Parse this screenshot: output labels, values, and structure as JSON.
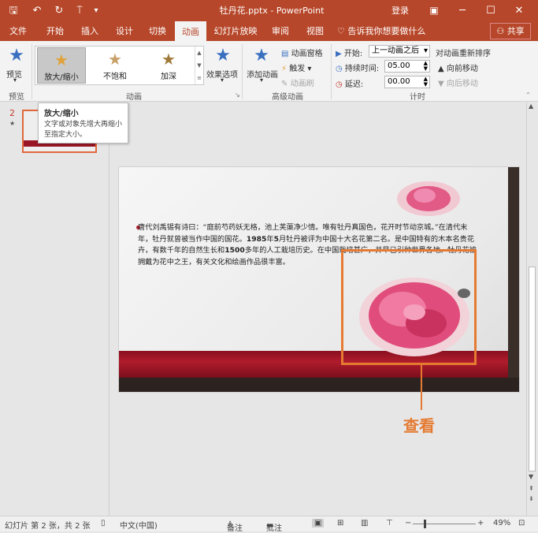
{
  "window": {
    "title": "牡丹花.pptx - PowerPoint",
    "login": "登录",
    "share": "共享",
    "search_hint": "告诉我你想要做什么"
  },
  "qat": {
    "save": "🖫",
    "undo": "↶",
    "redo": "↻",
    "present": "⍑",
    "more": "▾"
  },
  "tabs": [
    "文件",
    "开始",
    "插入",
    "设计",
    "切换",
    "动画",
    "幻灯片放映",
    "审阅",
    "视图"
  ],
  "ribbon": {
    "preview": {
      "label": "预览",
      "group": "预览"
    },
    "animations": {
      "items": [
        {
          "label": "放大/缩小",
          "color": "#e0a23a"
        },
        {
          "label": "不饱和",
          "color": "#c8a06a"
        },
        {
          "label": "加深",
          "color": "#a07a3a"
        }
      ],
      "effect_options": "效果选项",
      "group": "动画"
    },
    "advanced": {
      "add_animation": "添加动画",
      "pane": "动画窗格",
      "trigger": "触发",
      "painter": "动画刷",
      "group": "高级动画"
    },
    "timing": {
      "start_label": "开始:",
      "start_value": "上一动画之后",
      "duration_label": "持续时间:",
      "duration_value": "05.00",
      "delay_label": "延迟:",
      "delay_value": "00.00",
      "reorder_title": "对动画重新排序",
      "earlier": "向前移动",
      "later": "向后移动",
      "group": "计时"
    }
  },
  "tooltip": {
    "title": "放大/缩小",
    "desc": "文字或对象先增大再缩小至指定大小。"
  },
  "thumbnail": {
    "number": "2",
    "marker": "★"
  },
  "slide": {
    "body_a": "唐代刘禹锡有诗曰：“庭前芍药妖无格，池上芙蕖净少情。唯有牡丹真国色，花开时节动京城。”在清代末年，牡丹就曾被当作中国的国花。",
    "body_year": "1985",
    "body_b": "年",
    "body_month": "5",
    "body_c": "月牡丹被评为中国十大名花第二名。是中国特有的木本名贵花卉，有数千年的自然生长和",
    "body_years": "1500",
    "body_d": "多年的人工栽培历史。在中国栽培甚广，并早已引种世界各地。牡丹花被拥戴为花中之王，有关文化和绘画作品很丰富。"
  },
  "callout": "查看",
  "status": {
    "slide": "幻灯片 第 2 张，共 2 张",
    "language": "中文(中国)",
    "notes": "备注",
    "comments": "批注",
    "zoom": "49%"
  }
}
